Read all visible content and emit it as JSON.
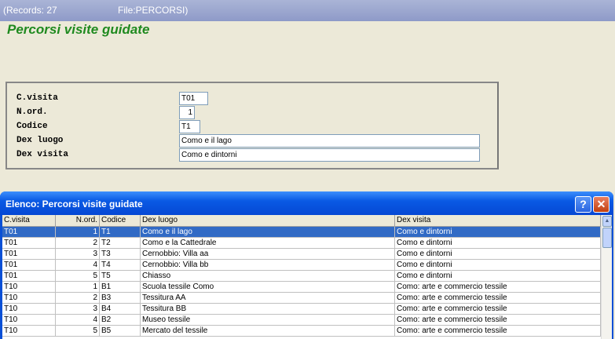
{
  "titlebar": {
    "records": "(Records: 27",
    "file": "File:PERCORSI)"
  },
  "form_title": "Percorsi visite guidate",
  "form": {
    "fields": [
      {
        "label": "C.visita",
        "value": "T01"
      },
      {
        "label": "N.ord.",
        "value": "1"
      },
      {
        "label": "Codice",
        "value": "T1"
      },
      {
        "label": "Dex luogo",
        "value": "Como e il lago"
      },
      {
        "label": "Dex visita",
        "value": "Como e dintorni"
      }
    ]
  },
  "dialog": {
    "title": "Elenco: Percorsi visite guidate",
    "help_label": "?",
    "close_label": "✕",
    "columns": [
      "C.visita",
      "N.ord.",
      "Codice",
      "Dex luogo",
      "Dex visita"
    ],
    "rows": [
      [
        "T01",
        "1",
        "T1",
        "Como e il lago",
        "Como e dintorni"
      ],
      [
        "T01",
        "2",
        "T2",
        "Como e la Cattedrale",
        "Como e dintorni"
      ],
      [
        "T01",
        "3",
        "T3",
        "Cernobbio: Villa aa",
        "Como e dintorni"
      ],
      [
        "T01",
        "4",
        "T4",
        "Cernobbio: Villa bb",
        "Como e dintorni"
      ],
      [
        "T01",
        "5",
        "T5",
        "Chiasso",
        "Como e dintorni"
      ],
      [
        "T10",
        "1",
        "B1",
        "Scuola tessile Como",
        "Como: arte e commercio tessile"
      ],
      [
        "T10",
        "2",
        "B3",
        "Tessitura AA",
        "Como: arte e commercio tessile"
      ],
      [
        "T10",
        "3",
        "B4",
        "Tessitura BB",
        "Como: arte e commercio tessile"
      ],
      [
        "T10",
        "4",
        "B2",
        "Museo tessile",
        "Como: arte e commercio tessile"
      ],
      [
        "T10",
        "5",
        "B5",
        "Mercato del tessile",
        "Como: arte e commercio tessile"
      ]
    ],
    "selected_row": 0
  },
  "colors": {
    "form_title": "#1f8a1f",
    "selection": "#316ac5",
    "dialog_title_bar": "#0a5ae4"
  }
}
